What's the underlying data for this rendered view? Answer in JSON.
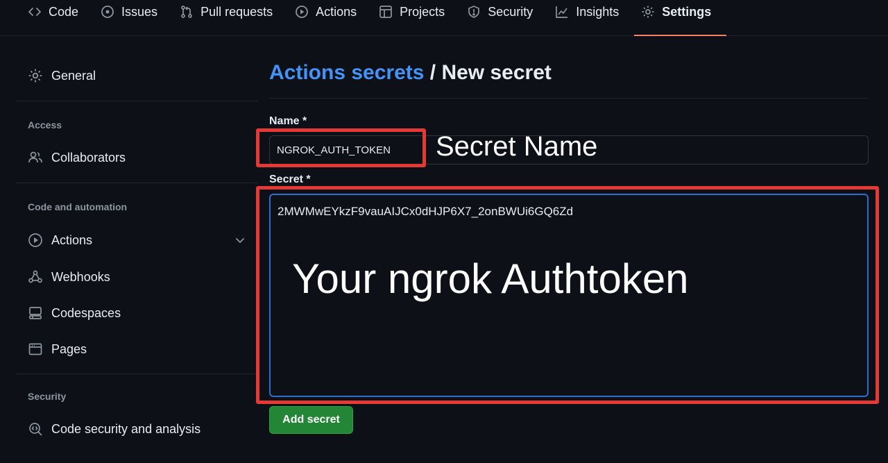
{
  "repo_nav": {
    "tabs": [
      {
        "label": "Code",
        "icon": "code-icon"
      },
      {
        "label": "Issues",
        "icon": "issue-circle-icon"
      },
      {
        "label": "Pull requests",
        "icon": "git-pull-request-icon"
      },
      {
        "label": "Actions",
        "icon": "play-circle-icon"
      },
      {
        "label": "Projects",
        "icon": "table-icon"
      },
      {
        "label": "Security",
        "icon": "shield-icon"
      },
      {
        "label": "Insights",
        "icon": "graph-icon"
      },
      {
        "label": "Settings",
        "icon": "gear-icon",
        "active": true
      }
    ]
  },
  "sidebar": {
    "general": "General",
    "access_heading": "Access",
    "collaborators": "Collaborators",
    "code_automation_heading": "Code and automation",
    "actions": "Actions",
    "webhooks": "Webhooks",
    "codespaces": "Codespaces",
    "pages": "Pages",
    "security_heading": "Security",
    "code_security": "Code security and analysis"
  },
  "main": {
    "breadcrumb_link": "Actions secrets",
    "breadcrumb_sep": " / ",
    "breadcrumb_current": "New secret",
    "name_label": "Name *",
    "name_value": "NGROK_AUTH_TOKEN",
    "secret_label": "Secret *",
    "secret_value": "2MWMwEYkzF9vauAIJCx0dHJP6X7_2onBWUi6GQ6Zd",
    "add_button": "Add secret"
  },
  "annotations": {
    "name_callout": "Secret Name",
    "secret_callout": "Your ngrok Authtoken",
    "highlight_color": "#e53935"
  },
  "colors": {
    "background": "#0d1117",
    "link": "#4493f8",
    "active_tab_underline": "#f78166",
    "primary_button": "#238636",
    "focus_border": "#316dca"
  }
}
